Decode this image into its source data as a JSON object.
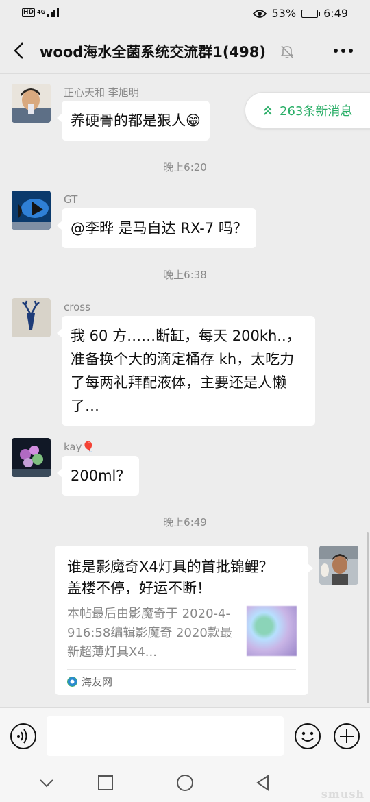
{
  "status_bar": {
    "hd_label": "HD",
    "network": "4G",
    "battery_percent": "53%",
    "battery_level": 0.53,
    "time": "6:49"
  },
  "header": {
    "title": "wood海水全菌系统交流群1(498)",
    "back_icon": "chevron-left-icon",
    "mute_icon": "bell-off-icon",
    "more_icon": "more-dots-icon"
  },
  "new_messages_badge": "263条新消息",
  "messages": [
    {
      "sender": "正心天和 李旭明",
      "text": "养硬骨的都是狠人😁"
    },
    {
      "time": "晚上6:20"
    },
    {
      "sender": "GT",
      "text": "@李晔  是马自达 RX-7 吗？"
    },
    {
      "time": "晚上6:38"
    },
    {
      "sender": "cross",
      "text": "我 60 方……断缸，每天 200kh..，准备换个大的滴定桶存 kh，太吃力了每两礼拜配液体，主要还是人懒了…"
    },
    {
      "sender": "kay🎈",
      "text": "200ml？"
    },
    {
      "time": "晚上6:49"
    }
  ],
  "link_card": {
    "title": "谁是影魔奇X4灯具的首批锦鲤？盖楼不停，好运不断！",
    "description": "本帖最后由影魔奇于 2020-4-916:58编辑影魔奇 2020款最新超薄灯具X4...",
    "source": "海友网"
  },
  "input_bar": {
    "voice_icon": "voice-icon",
    "emoji_icon": "emoji-icon",
    "plus_icon": "plus-icon",
    "placeholder": ""
  },
  "system_nav": {
    "icons": [
      "chevron-down-icon",
      "square-icon",
      "circle-icon",
      "triangle-back-icon"
    ],
    "watermark": "smush"
  }
}
